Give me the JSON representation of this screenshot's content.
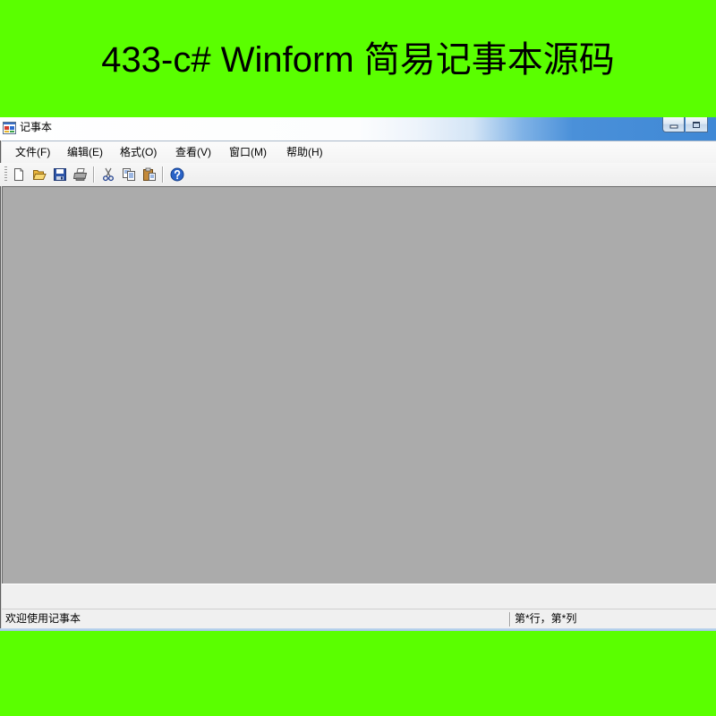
{
  "banner": {
    "title": "433-c# Winform 简易记事本源码"
  },
  "window": {
    "title": "记事本",
    "icon": "app-form-icon",
    "controls": [
      "minimize-icon",
      "maximize-icon"
    ]
  },
  "menu": {
    "items": [
      {
        "label": "文件(F)"
      },
      {
        "label": "编辑(E)"
      },
      {
        "label": "格式(O)"
      },
      {
        "label": "查看(V)"
      },
      {
        "label": "窗口(M)"
      },
      {
        "label": "帮助(H)"
      }
    ]
  },
  "toolbar": {
    "buttons": [
      {
        "icon": "new-file-icon"
      },
      {
        "icon": "open-folder-icon"
      },
      {
        "icon": "save-icon"
      },
      {
        "icon": "print-icon"
      },
      {
        "icon": "cut-icon"
      },
      {
        "icon": "copy-icon"
      },
      {
        "icon": "paste-icon"
      },
      {
        "icon": "help-icon"
      }
    ]
  },
  "status": {
    "message": "欢迎使用记事本",
    "position": "第*行，第*列"
  },
  "colors": {
    "background": "#5aff00",
    "mdi_client": "#ababab",
    "chrome": "#f0f0f0",
    "title_accent": "#3f88d5"
  }
}
